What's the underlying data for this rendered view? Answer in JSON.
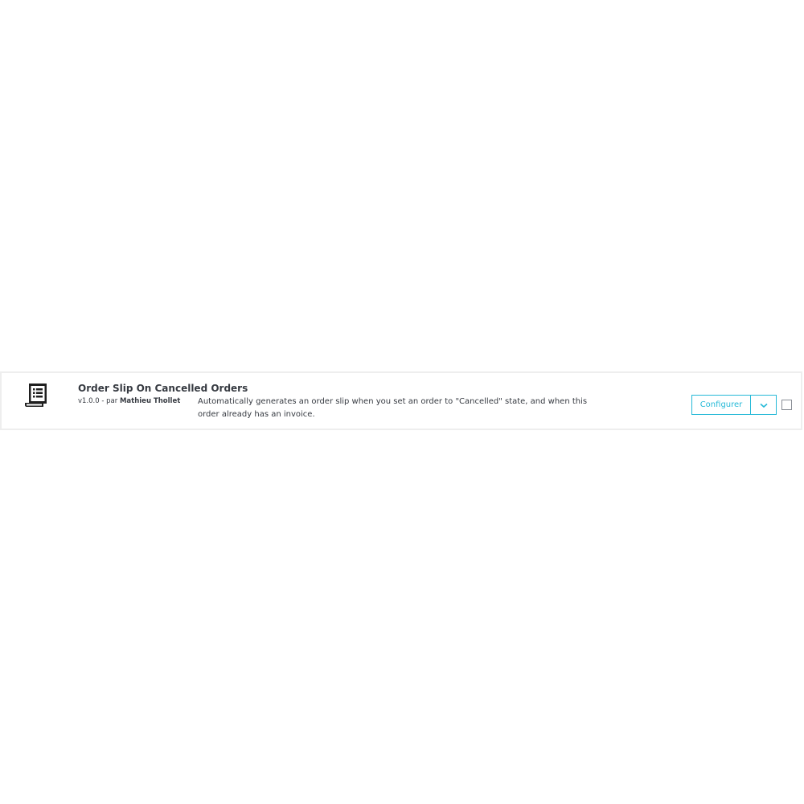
{
  "module": {
    "icon": "order-slip-receipt-icon",
    "title": "Order Slip On Cancelled Orders",
    "version": "v1.0.0",
    "by_label": "- par",
    "author": "Mathieu Thollet",
    "description": "Automatically generates an order slip when you set an order to \"Cancelled\" state, and when this order already has an invoice."
  },
  "actions": {
    "configure_label": "Configurer",
    "dropdown_icon": "chevron-down-icon",
    "checkbox_checked": false
  },
  "colors": {
    "accent": "#25b9d7",
    "text": "#363a41",
    "border": "#eeeeee"
  }
}
